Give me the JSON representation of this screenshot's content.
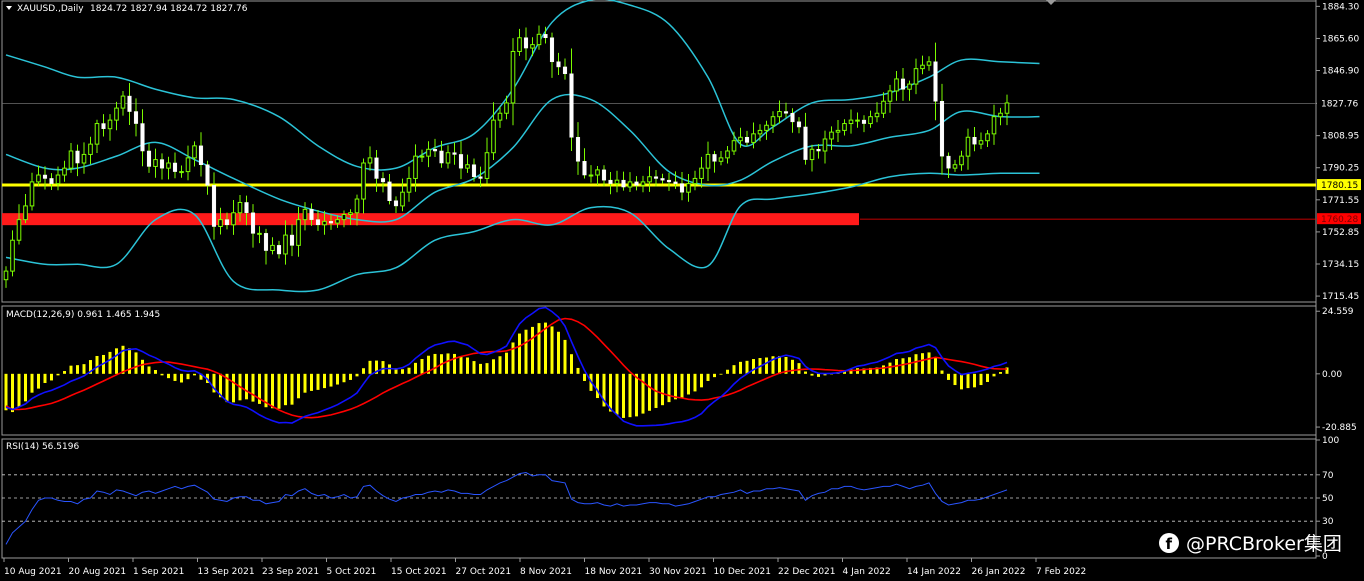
{
  "chart_data": [
    {
      "type": "candlestick",
      "title": "XAUUSD.,Daily",
      "ohlc_header": "1824.72 1827.94 1824.72 1827.76",
      "ylim": [
        1712,
        1888
      ],
      "y_ticks": [
        "1884.30",
        "1865.60",
        "1846.90",
        "1827.76",
        "1808.95",
        "1790.25",
        "1771.55",
        "1752.85",
        "1734.15",
        "1715.45"
      ],
      "price_labels": [
        {
          "text": "1827.76",
          "value": 1827.76,
          "color": "#ffffff",
          "bg": "#000000"
        },
        {
          "text": "1780.15",
          "value": 1780.15,
          "color": "#000000",
          "bg": "#ffff00"
        },
        {
          "text": "1760.28",
          "value": 1760.28,
          "color": "#ff0000",
          "bg": "#ff0000"
        }
      ],
      "levels": [
        {
          "value": 1780.15,
          "color": "#ffff00",
          "style": "solid"
        },
        {
          "value": 1760.28,
          "color": "#ff0000",
          "style": "band"
        }
      ],
      "x_labels": [
        "10 Aug 2021",
        "20 Aug 2021",
        "1 Sep 2021",
        "13 Sep 2021",
        "23 Sep 2021",
        "5 Oct 2021",
        "15 Oct 2021",
        "27 Oct 2021",
        "8 Nov 2021",
        "18 Nov 2021",
        "30 Nov 2021",
        "10 Dec 2021",
        "22 Dec 2021",
        "4 Jan 2022",
        "14 Jan 2022",
        "26 Jan 2022",
        "7 Feb 2022"
      ],
      "closes": [
        1730,
        1748,
        1760,
        1768,
        1782,
        1786,
        1784,
        1781,
        1786,
        1790,
        1800,
        1793,
        1798,
        1804,
        1816,
        1813,
        1818,
        1825,
        1832,
        1823,
        1816,
        1800,
        1791,
        1795,
        1790,
        1793,
        1788,
        1788,
        1796,
        1803,
        1792,
        1780,
        1756,
        1760,
        1757,
        1764,
        1770,
        1764,
        1752,
        1752,
        1742,
        1745,
        1740,
        1751,
        1745,
        1760,
        1766,
        1760,
        1757,
        1759,
        1758,
        1760,
        1763,
        1764,
        1772,
        1793,
        1796,
        1784,
        1782,
        1771,
        1768,
        1776,
        1784,
        1797,
        1797,
        1801,
        1800,
        1793,
        1799,
        1798,
        1790,
        1792,
        1785,
        1784,
        1799,
        1818,
        1822,
        1828,
        1858,
        1866,
        1860,
        1862,
        1868,
        1866,
        1852,
        1849,
        1845,
        1808,
        1794,
        1786,
        1786,
        1789,
        1783,
        1781,
        1783,
        1779,
        1782,
        1780,
        1782,
        1785,
        1784,
        1783,
        1782,
        1781,
        1776,
        1781,
        1784,
        1790,
        1798,
        1794,
        1796,
        1800,
        1806,
        1808,
        1805,
        1810,
        1812,
        1815,
        1820,
        1823,
        1822,
        1817,
        1814,
        1795,
        1801,
        1800,
        1807,
        1811,
        1812,
        1816,
        1818,
        1818,
        1816,
        1820,
        1822,
        1829,
        1835,
        1842,
        1836,
        1839,
        1848,
        1850,
        1852,
        1829,
        1797,
        1790,
        1792,
        1797,
        1808,
        1804,
        1806,
        1810,
        1820,
        1822,
        1828
      ],
      "bollinger": {
        "upper": [
          [
            0,
            1856
          ],
          [
            6,
            1849
          ],
          [
            11,
            1843
          ],
          [
            17,
            1843
          ],
          [
            23,
            1836
          ],
          [
            29,
            1831
          ],
          [
            35,
            1830
          ],
          [
            42,
            1820
          ],
          [
            48,
            1803
          ],
          [
            54,
            1791
          ],
          [
            60,
            1790
          ],
          [
            66,
            1802
          ],
          [
            72,
            1810
          ],
          [
            78,
            1836
          ],
          [
            84,
            1875
          ],
          [
            90,
            1888
          ],
          [
            96,
            1885
          ],
          [
            102,
            1874
          ],
          [
            108,
            1843
          ],
          [
            113,
            1804
          ],
          [
            118,
            1814
          ],
          [
            124,
            1828
          ],
          [
            130,
            1830
          ],
          [
            136,
            1834
          ],
          [
            142,
            1843
          ],
          [
            147,
            1853
          ],
          [
            153,
            1852
          ],
          [
            159,
            1851
          ]
        ],
        "middle": [
          [
            0,
            1798
          ],
          [
            6,
            1790
          ],
          [
            11,
            1790
          ],
          [
            17,
            1797
          ],
          [
            23,
            1805
          ],
          [
            29,
            1795
          ],
          [
            35,
            1784
          ],
          [
            42,
            1772
          ],
          [
            48,
            1765
          ],
          [
            54,
            1760
          ],
          [
            60,
            1760
          ],
          [
            66,
            1776
          ],
          [
            72,
            1784
          ],
          [
            78,
            1802
          ],
          [
            84,
            1830
          ],
          [
            90,
            1830
          ],
          [
            96,
            1812
          ],
          [
            102,
            1788
          ],
          [
            108,
            1780
          ],
          [
            113,
            1783
          ],
          [
            118,
            1794
          ],
          [
            124,
            1803
          ],
          [
            130,
            1803
          ],
          [
            136,
            1808
          ],
          [
            142,
            1812
          ],
          [
            147,
            1823
          ],
          [
            153,
            1820
          ],
          [
            159,
            1820
          ]
        ],
        "lower": [
          [
            0,
            1738
          ],
          [
            6,
            1734
          ],
          [
            11,
            1734
          ],
          [
            17,
            1734
          ],
          [
            23,
            1760
          ],
          [
            29,
            1763
          ],
          [
            35,
            1724
          ],
          [
            42,
            1719
          ],
          [
            48,
            1719
          ],
          [
            54,
            1728
          ],
          [
            60,
            1732
          ],
          [
            66,
            1748
          ],
          [
            72,
            1753
          ],
          [
            78,
            1760
          ],
          [
            84,
            1757
          ],
          [
            90,
            1767
          ],
          [
            96,
            1764
          ],
          [
            102,
            1743
          ],
          [
            108,
            1733
          ],
          [
            113,
            1768
          ],
          [
            118,
            1772
          ],
          [
            124,
            1775
          ],
          [
            130,
            1779
          ],
          [
            136,
            1785
          ],
          [
            142,
            1787
          ],
          [
            147,
            1786
          ],
          [
            153,
            1787
          ],
          [
            159,
            1787
          ]
        ]
      }
    },
    {
      "type": "bar+line",
      "title": "MACD(12,26,9) 0.961 1.465 1.945",
      "ylim": [
        -24,
        27
      ],
      "y_ticks": [
        "24.559",
        "0.00",
        "-20.885"
      ],
      "histogram": [
        -14.3,
        -15.0,
        -12.9,
        -10.8,
        -7.4,
        -5.8,
        -3.6,
        -2.6,
        -0.6,
        1.1,
        3.2,
        3.4,
        3.8,
        5.4,
        7.0,
        7.4,
        8.6,
        10.0,
        11.0,
        10.0,
        8.4,
        5.5,
        2.9,
        1.5,
        -0.6,
        -1.7,
        -2.8,
        -3.4,
        -2.1,
        -0.6,
        -2.3,
        -3.6,
        -7.3,
        -9.2,
        -11.1,
        -11.2,
        -10.4,
        -10.0,
        -10.9,
        -11.8,
        -13.1,
        -13.5,
        -13.7,
        -12.3,
        -12.1,
        -9.6,
        -7.4,
        -6.7,
        -6.3,
        -5.6,
        -5.0,
        -4.2,
        -3.3,
        -2.4,
        -1.0,
        2.2,
        5.1,
        5.2,
        5.0,
        3.7,
        2.2,
        1.8,
        2.4,
        4.3,
        5.8,
        7.1,
        7.8,
        7.7,
        8.0,
        7.8,
        6.9,
        6.4,
        5.0,
        3.9,
        4.2,
        5.7,
        6.9,
        8.3,
        12.3,
        15.8,
        17.3,
        18.4,
        19.9,
        20.1,
        18.6,
        16.5,
        13.3,
        7.7,
        2.3,
        -2.8,
        -6.7,
        -9.5,
        -12.8,
        -14.8,
        -16.0,
        -17.3,
        -17.0,
        -16.7,
        -15.6,
        -14.5,
        -13.4,
        -12.3,
        -11.1,
        -10.0,
        -9.3,
        -8.1,
        -6.9,
        -5.3,
        -2.8,
        -1.3,
        0.0,
        1.6,
        3.4,
        4.7,
        5.1,
        5.8,
        6.2,
        6.4,
        6.9,
        7.0,
        6.6,
        5.5,
        4.2,
        0.9,
        -0.7,
        -1.2,
        -0.6,
        0.1,
        0.7,
        1.3,
        1.8,
        2.2,
        2.1,
        2.3,
        2.5,
        3.3,
        4.4,
        5.8,
        6.1,
        6.5,
        7.7,
        8.1,
        8.4,
        6.3,
        1.3,
        -2.4,
        -4.4,
        -6.1,
        -5.6,
        -5.3,
        -4.4,
        -3.2,
        -1.0,
        0.7,
        2.5
      ],
      "macd": [
        -13.1,
        -14.0,
        -13.0,
        -11.8,
        -9.7,
        -8.3,
        -7.2,
        -6.5,
        -5.4,
        -4.3,
        -2.9,
        -1.9,
        -0.8,
        0.9,
        2.7,
        4.0,
        5.5,
        7.2,
        9.1,
        9.6,
        9.8,
        8.7,
        7.3,
        6.3,
        4.9,
        3.8,
        2.4,
        1.4,
        1.0,
        1.2,
        -0.1,
        -2.1,
        -5.7,
        -8.3,
        -10.8,
        -12.0,
        -12.4,
        -13.1,
        -14.5,
        -16.1,
        -17.4,
        -18.4,
        -19.2,
        -19.1,
        -19.3,
        -18.0,
        -16.7,
        -15.9,
        -15.2,
        -14.2,
        -13.2,
        -12.1,
        -10.7,
        -9.3,
        -7.5,
        -3.9,
        -0.5,
        0.9,
        2.0,
        2.1,
        1.9,
        2.4,
        3.7,
        6.1,
        8.1,
        10.0,
        11.3,
        11.9,
        12.6,
        12.8,
        12.0,
        11.3,
        9.6,
        7.9,
        7.6,
        8.5,
        9.5,
        10.9,
        15.4,
        19.6,
        22.0,
        23.7,
        25.6,
        26.0,
        24.4,
        22.2,
        18.7,
        12.6,
        6.8,
        1.4,
        -3.1,
        -6.5,
        -10.6,
        -13.7,
        -16.1,
        -18.6,
        -19.6,
        -20.4,
        -20.4,
        -20.3,
        -20.2,
        -20.0,
        -19.6,
        -19.1,
        -18.8,
        -18.1,
        -17.1,
        -15.6,
        -12.9,
        -10.8,
        -9.0,
        -6.7,
        -4.0,
        -1.7,
        0.0,
        1.6,
        2.9,
        4.2,
        5.6,
        6.6,
        7.3,
        6.8,
        6.0,
        2.9,
        1.2,
        0.2,
        0.1,
        0.2,
        0.4,
        1.0,
        2.0,
        3.0,
        3.4,
        4.1,
        4.6,
        5.6,
        6.7,
        8.0,
        8.3,
        8.8,
        10.1,
        10.7,
        11.5,
        10.3,
        6.4,
        3.1,
        1.3,
        -0.3,
        0.2,
        0.6,
        1.2,
        1.9,
        2.9,
        3.5,
        4.5
      ],
      "signal": [
        -12.6,
        -13.9,
        -14.0,
        -13.8,
        -13.3,
        -12.7,
        -12.2,
        -11.6,
        -10.7,
        -9.7,
        -8.5,
        -7.4,
        -6.4,
        -5.2,
        -4.0,
        -2.8,
        -1.6,
        -0.4,
        0.8,
        1.8,
        2.8,
        3.6,
        4.0,
        4.4,
        4.6,
        4.6,
        4.2,
        3.8,
        3.3,
        2.8,
        2.3,
        1.8,
        0.9,
        -0.2,
        -1.7,
        -3.4,
        -5.1,
        -6.7,
        -8.2,
        -9.8,
        -11.3,
        -12.8,
        -14.2,
        -15.3,
        -16.2,
        -16.8,
        -17.1,
        -17.2,
        -17.0,
        -16.6,
        -16.1,
        -15.4,
        -14.7,
        -13.9,
        -12.9,
        -11.7,
        -10.4,
        -9.0,
        -7.5,
        -6.2,
        -5.0,
        -3.8,
        -2.7,
        -1.4,
        -0.1,
        1.0,
        2.3,
        3.8,
        5.0,
        6.0,
        6.8,
        7.4,
        8.0,
        8.3,
        8.6,
        8.7,
        8.7,
        9.0,
        9.8,
        10.8,
        12.3,
        14.0,
        15.9,
        17.8,
        19.6,
        21.1,
        21.7,
        21.4,
        20.4,
        18.9,
        16.7,
        14.3,
        11.6,
        8.9,
        6.2,
        3.4,
        0.8,
        -1.4,
        -3.2,
        -5.2,
        -6.8,
        -7.7,
        -8.5,
        -9.1,
        -9.5,
        -10.0,
        -10.2,
        -10.3,
        -10.1,
        -9.5,
        -9.0,
        -8.3,
        -7.4,
        -6.4,
        -5.1,
        -4.0,
        -2.9,
        -1.8,
        -0.7,
        0.3,
        0.9,
        1.3,
        1.6,
        1.8,
        1.9,
        1.8,
        1.6,
        1.5,
        1.3,
        1.2,
        1.3,
        1.4,
        1.7,
        1.9,
        2.1,
        2.3,
        2.7,
        3.1,
        3.6,
        4.1,
        4.7,
        5.3,
        5.9,
        6.5,
        6.1,
        5.6,
        5.2,
        4.8,
        4.3,
        3.7,
        3.0,
        2.4,
        2.0,
        1.9,
        1.9
      ]
    },
    {
      "type": "line",
      "title": "RSI(14) 56.5196",
      "ylim": [
        0,
        100
      ],
      "y_ticks": [
        "100",
        "70",
        "50",
        "30",
        "0"
      ],
      "levels": [
        70,
        50,
        30
      ],
      "values": [
        10,
        20,
        25,
        30,
        40,
        48,
        50,
        50,
        48,
        47,
        47,
        45,
        49,
        50,
        56,
        55,
        53,
        57,
        56,
        54,
        52,
        55,
        56,
        54,
        56,
        58,
        60,
        58,
        60,
        61,
        58,
        55,
        49,
        48,
        47,
        50,
        51,
        51,
        48,
        48,
        45,
        46,
        47,
        53,
        52,
        56,
        58,
        54,
        52,
        53,
        50,
        51,
        53,
        50,
        51,
        60,
        61,
        56,
        52,
        49,
        47,
        50,
        51,
        53,
        53,
        55,
        56,
        55,
        57,
        56,
        54,
        54,
        53,
        53,
        57,
        60,
        63,
        65,
        68,
        71,
        72,
        69,
        70,
        70,
        65,
        64,
        63,
        49,
        46,
        45,
        45,
        46,
        44,
        43,
        45,
        43,
        44,
        44,
        45,
        46,
        46,
        45,
        45,
        43,
        44,
        45,
        47,
        49,
        51,
        51,
        53,
        54,
        55,
        57,
        54,
        56,
        56,
        58,
        58,
        59,
        58,
        57,
        56,
        48,
        52,
        54,
        55,
        58,
        58,
        60,
        60,
        58,
        57,
        58,
        59,
        60,
        60,
        62,
        60,
        58,
        60,
        61,
        63,
        54,
        47,
        44,
        45,
        46,
        48,
        48,
        49,
        51,
        53,
        55,
        57
      ]
    }
  ],
  "watermark": {
    "text": "@PRCBroker集团",
    "icon": "facebook-icon"
  }
}
